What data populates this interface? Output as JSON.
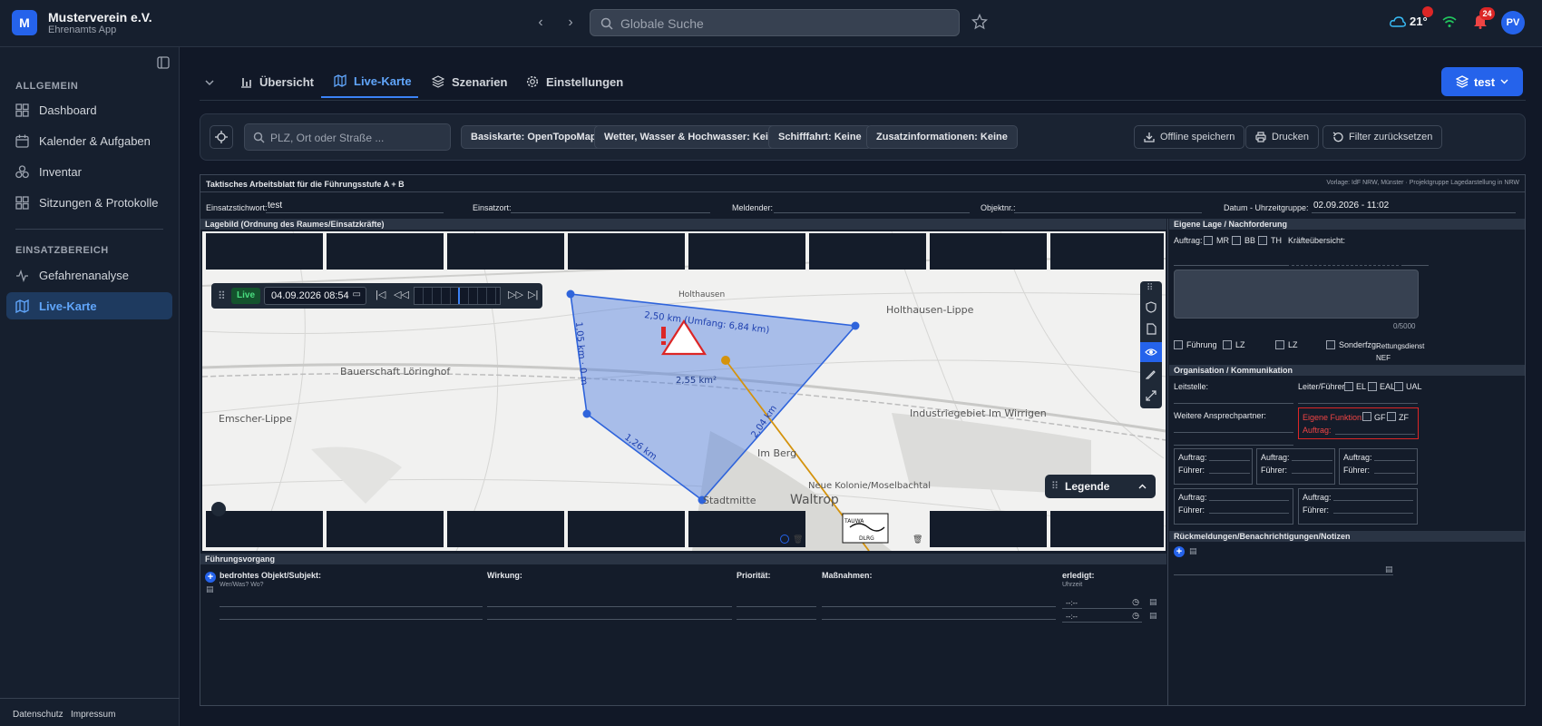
{
  "app": {
    "logo_letter": "M",
    "name": "Musterverein e.V.",
    "subtitle": "Ehrenamts App"
  },
  "header": {
    "search_placeholder": "Globale Suche",
    "weather_temp": "21°",
    "notifications_count": "24",
    "avatar_initials": "PV"
  },
  "sidebar": {
    "section_general": "ALLGEMEIN",
    "items_general": [
      {
        "label": "Dashboard",
        "icon": "grid-icon"
      },
      {
        "label": "Kalender & Aufgaben",
        "icon": "calendar-icon"
      },
      {
        "label": "Inventar",
        "icon": "boxes-icon"
      },
      {
        "label": "Sitzungen & Protokolle",
        "icon": "grid-icon"
      }
    ],
    "section_ops": "EINSATZBEREICH",
    "items_ops": [
      {
        "label": "Gefahrenanalyse",
        "icon": "pulse-icon"
      },
      {
        "label": "Live-Karte",
        "icon": "map-icon",
        "active": true
      }
    ],
    "footer_privacy": "Datenschutz",
    "footer_imprint": "Impressum"
  },
  "tabs": [
    {
      "label": "Übersicht"
    },
    {
      "label": "Live-Karte",
      "active": true
    },
    {
      "label": "Szenarien"
    },
    {
      "label": "Einstellungen"
    }
  ],
  "workspace_button": "test",
  "toolbar": {
    "search_placeholder": "PLZ, Ort oder Straße ...",
    "chips": [
      "Basiskarte: OpenTopoMap",
      "Wetter, Wasser & Hochwasser: Keine",
      "Schifffahrt: Keine",
      "Zusatzinformationen: Keine"
    ],
    "offline": "Offline speichern",
    "print": "Drucken",
    "reset": "Filter zurücksetzen"
  },
  "sheet": {
    "title": "Taktisches Arbeitsblatt für die Führungsstufe A + B",
    "template_note": "Vorlage: IdF NRW, Münster · Projektgruppe Lagedarstellung in NRW",
    "einsatzstichwort_label": "Einsatzstichwort:",
    "einsatzstichwort_value": "test",
    "einsatzort_label": "Einsatzort:",
    "meldender_label": "Meldender:",
    "objektnr_label": "Objektnr.:",
    "datum_label": "Datum - Uhrzeitgruppe:",
    "datum_value": "02.09.2026 - 11:02",
    "lagebild_title": "Lagebild (Ordnung des Raumes/Einsatzkräfte)",
    "fuehrungsvorgang_title": "Führungsvorgang",
    "fv_col1": "bedrohtes Objekt/Subjekt:",
    "fv_col1_sub": "Wer/Was? Wo?",
    "fv_col2": "Wirkung:",
    "fv_col3": "Priorität:",
    "fv_col4": "Maßnahmen:",
    "fv_col5": "erledigt:",
    "fv_col5_sub": "Uhrzeit",
    "fv_time1": "--:--",
    "fv_time2": "--:--"
  },
  "map": {
    "live_label": "Live",
    "datetime": "04.09.2026 08:54",
    "legend_label": "Legende",
    "places": [
      "Holthausen",
      "Holthausen-Lippe",
      "Bauerschaft Löringhof",
      "Emscher-Lippe",
      "Industriegebiet Im Wirrigen",
      "Im Berg",
      "Neue Kolonie/Moselbachtal",
      "Waltrop",
      "Stadtmitte"
    ],
    "measure_top": "2,50 km (Umfang: 6,84 km)",
    "measure_left": "1,05 km · 0 m",
    "measure_area": "2,55 km²",
    "measure_bottom_left": "1,26 km",
    "measure_right": "2,04 km",
    "sign_text": "DLRG",
    "sign_top": "TAUWA"
  },
  "right": {
    "eigene_lage_title": "Eigene Lage / Nachforderung",
    "auftrag_label": "Auftrag:",
    "opt_mr": "MR",
    "opt_bb": "BB",
    "opt_th": "TH",
    "kraefte_label": "Kräfteübersicht:",
    "counter": "0/5000",
    "opt_fuehrung": "Führung",
    "opt_lz1": "LZ",
    "opt_lz2": "LZ",
    "opt_sonder": "Sonderfzg.",
    "rettungsdienst": "Rettungsdienst",
    "nef": "NEF",
    "org_title": "Organisation / Kommunikation",
    "leitstelle_label": "Leitstelle:",
    "leiter_label": "Leiter/Führer:",
    "opt_el": "EL",
    "opt_eal": "EAL",
    "opt_ual": "UAL",
    "weitere_label": "Weitere Ansprechpartner:",
    "eigene_funktion": "Eigene Funktion:",
    "opt_gf": "GF",
    "opt_zf": "ZF",
    "auftrag_red": "Auftrag:",
    "auftrag_box": "Auftrag:",
    "fuehrer_box": "Führer:",
    "rueck_title": "Rückmeldungen/Benachrichtigungen/Notizen"
  },
  "colors": {
    "accent": "#2563eb",
    "polygon": "#3b82f6",
    "route": "#d4930d",
    "danger": "#dc2626"
  }
}
